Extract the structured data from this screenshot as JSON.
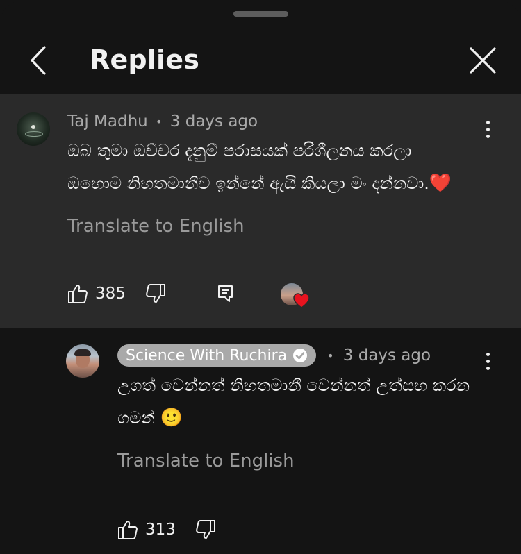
{
  "header": {
    "title": "Replies"
  },
  "comment": {
    "author": "Taj Madhu",
    "separator": "•",
    "time": "3 days ago",
    "text_line1": "ඔබ තුමා ඔච්චර දැනුම් පරාසයක් පරිශීලනය කරලා",
    "text_line2": "ඔහොම නිහතමානීව ඉන්නේ ඇයි කියලා මං දන්නවා.",
    "emoji": "❤️",
    "translate_label": "Translate to English",
    "likes": "385"
  },
  "reply": {
    "author": "Science With Ruchira",
    "separator": "•",
    "time": "3 days ago",
    "text_line1": "උගත් වෙන්නත් නිහතමානී වෙන්නත් උත්සහ කරන",
    "text_line2": "ගමන්",
    "emoji": "🙂",
    "translate_label": "Translate to English",
    "likes": "313"
  },
  "icons": {
    "back": "chevron-left-icon",
    "close": "close-icon",
    "more": "more-vertical-icon",
    "like": "thumbs-up-icon",
    "dislike": "thumbs-down-icon",
    "reply": "comment-icon",
    "creator_heart": "creator-heart-icon",
    "verified": "verified-check-icon"
  },
  "colors": {
    "background": "#141414",
    "highlight": "#2a2a2a",
    "text": "#f1f1f1",
    "muted": "#aaaaaa",
    "heart": "#e8131f",
    "chip": "#a9a9a9"
  }
}
